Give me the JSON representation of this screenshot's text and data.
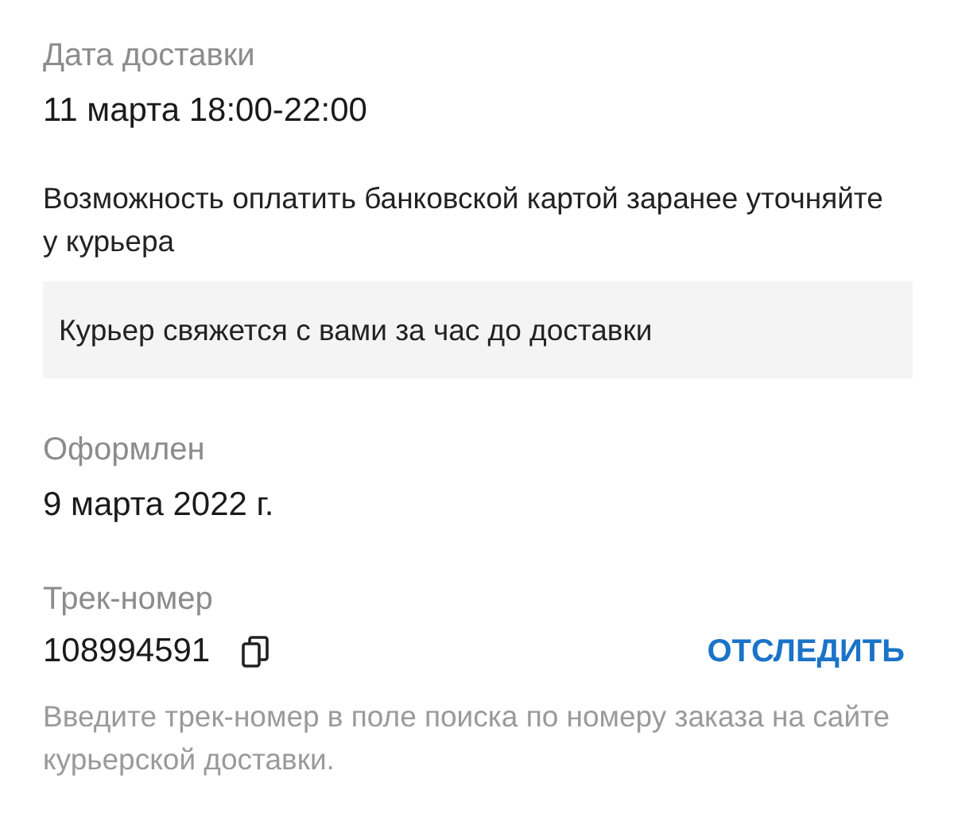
{
  "delivery_date": {
    "label": "Дата доставки",
    "value": "11 марта 18:00-22:00"
  },
  "payment_note": "Возможность оплатить банковской картой заранее уточняйте у курьера",
  "courier_notice": "Курьер свяжется с вами за час до доставки",
  "created": {
    "label": "Оформлен",
    "value": "9 марта 2022 г."
  },
  "tracking": {
    "label": "Трек-номер",
    "value": "108994591",
    "action": "ОТСЛЕДИТЬ",
    "hint": "Введите трек-номер в поле поиска по номеру заказа на сайте курьерской доставки."
  }
}
